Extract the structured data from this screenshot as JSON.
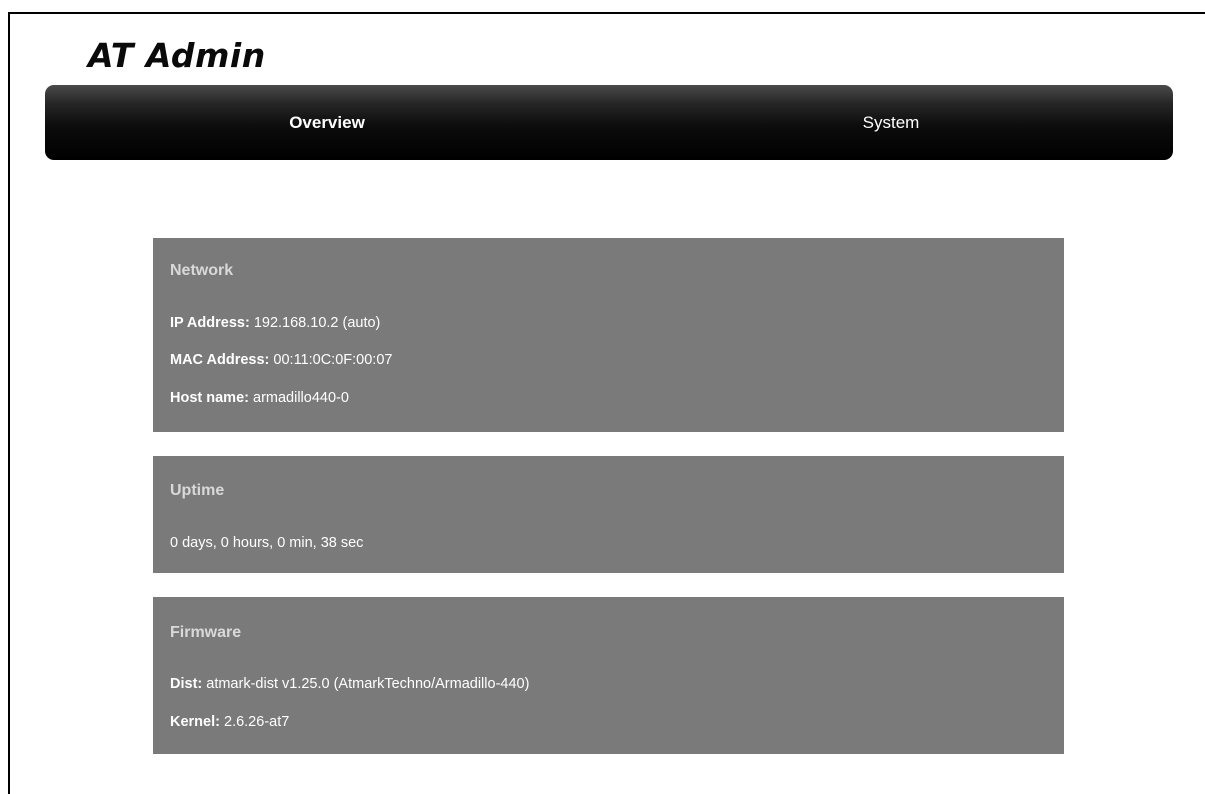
{
  "app": {
    "title": "AT Admin"
  },
  "nav": {
    "tabs": [
      {
        "label": "Overview",
        "active": true
      },
      {
        "label": "System",
        "active": false
      }
    ]
  },
  "network": {
    "title": "Network",
    "ip_label": "IP Address:",
    "ip_value": "192.168.10.2 (auto)",
    "mac_label": "MAC Address:",
    "mac_value": "00:11:0C:0F:00:07",
    "host_label": "Host name:",
    "host_value": "armadillo440-0"
  },
  "uptime": {
    "title": "Uptime",
    "value": "0 days, 0 hours, 0 min, 38 sec"
  },
  "firmware": {
    "title": "Firmware",
    "dist_label": "Dist:",
    "dist_value": "atmark-dist v1.25.0 (AtmarkTechno/Armadillo-440)",
    "kernel_label": "Kernel:",
    "kernel_value": "2.6.26-at7"
  },
  "colors": {
    "nav_background": "#000000",
    "panel_background": "#7a7a7a",
    "panel_title": "#d9d9d9",
    "panel_text": "#ffffff"
  }
}
